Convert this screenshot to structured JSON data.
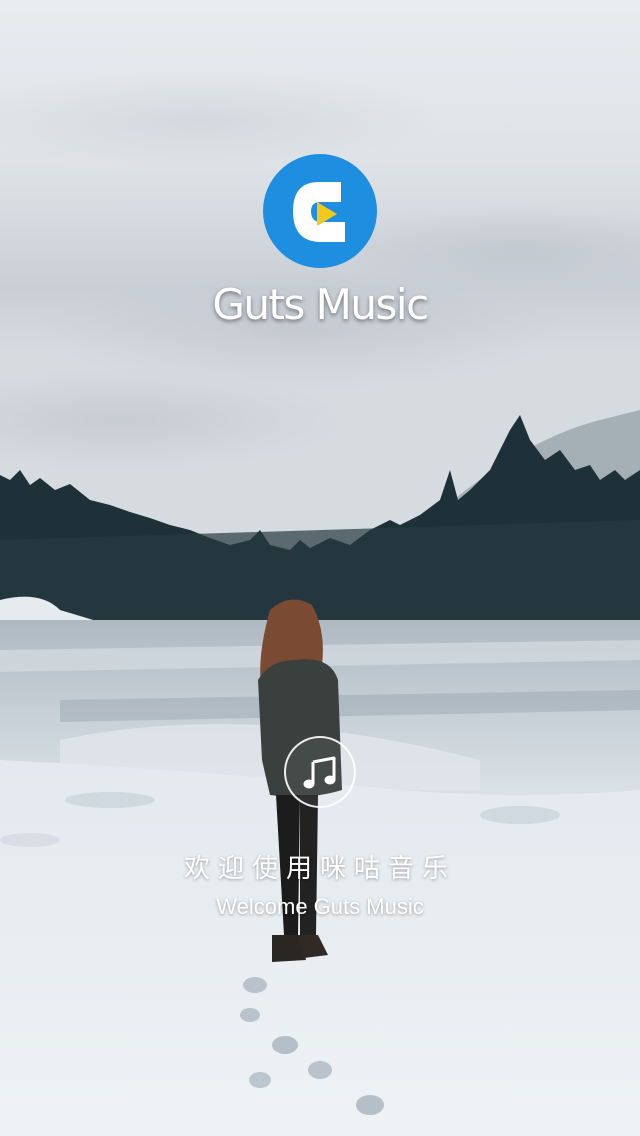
{
  "app": {
    "name": "Guts Music",
    "logo_icon": "play-c-logo-icon",
    "brand_color": "#1e8fe0"
  },
  "background": {
    "scene": "snowy-lake-forest-photo",
    "icon": "background-photo"
  },
  "music_button": {
    "icon": "music-note-icon"
  },
  "welcome": {
    "chinese": "欢迎使用咪咕音乐",
    "english": "Welcome Guts Music"
  }
}
